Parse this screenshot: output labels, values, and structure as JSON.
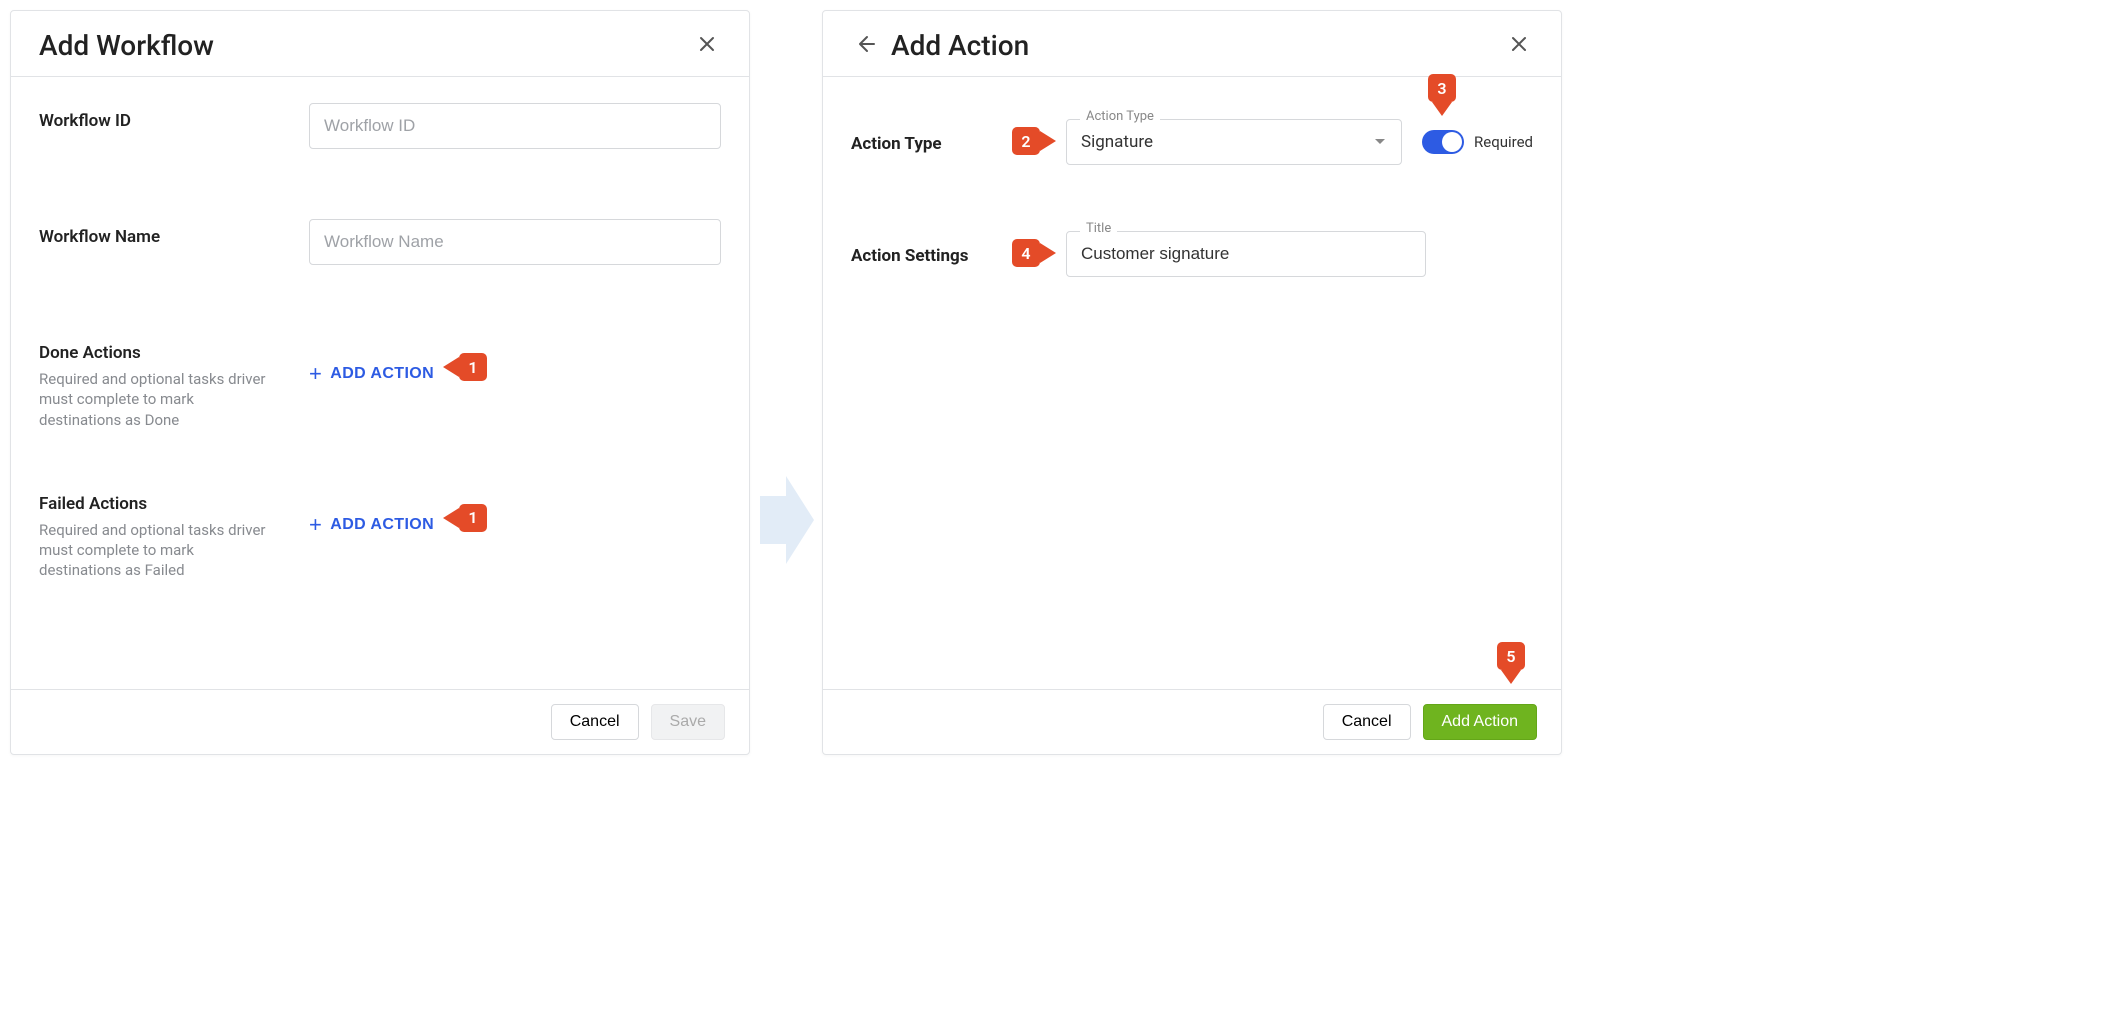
{
  "left": {
    "title": "Add Workflow",
    "workflow_id": {
      "label": "Workflow ID",
      "placeholder": "Workflow ID"
    },
    "workflow_name": {
      "label": "Workflow Name",
      "placeholder": "Workflow Name"
    },
    "done_actions": {
      "label": "Done Actions",
      "help": "Required and optional tasks driver must complete to mark destinations as Done",
      "add_label": "ADD ACTION"
    },
    "failed_actions": {
      "label": "Failed Actions",
      "help": "Required and optional tasks driver must complete to mark destinations as Failed",
      "add_label": "ADD ACTION"
    },
    "footer": {
      "cancel": "Cancel",
      "save": "Save"
    }
  },
  "right": {
    "title": "Add Action",
    "action_type": {
      "label": "Action Type",
      "field_label": "Action Type",
      "value": "Signature",
      "required_label": "Required"
    },
    "action_settings": {
      "label": "Action Settings",
      "title_field_label": "Title",
      "title_value": "Customer signature"
    },
    "footer": {
      "cancel": "Cancel",
      "add": "Add Action"
    }
  },
  "annotations": {
    "m1": "1",
    "m2": "2",
    "m3": "3",
    "m4": "4",
    "m5": "5"
  }
}
